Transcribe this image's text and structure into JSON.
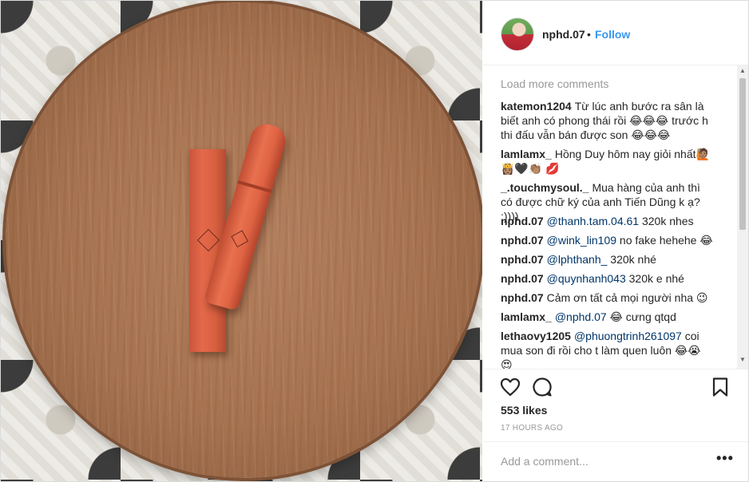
{
  "post": {
    "username": "nphd.07",
    "separator": "•",
    "follow_label": "Follow",
    "avatar_icon": "profile-avatar"
  },
  "comments": {
    "load_more": "Load more comments",
    "items": [
      {
        "user": "katemon1204",
        "mention": "",
        "text": "Từ lúc anh bước ra sân là biết anh có phong thái rồi 😂😂😂 trước h thi đấu vẫn bán được son 😂😂😂"
      },
      {
        "user": "lamlamx_",
        "mention": "",
        "text": "Hồng Duy hôm nay giỏi nhất🙋🏽 👸🏽🖤👏🏽 💋"
      },
      {
        "user": "_.touchmysoul._",
        "mention": "",
        "text": "Mua hàng của anh thì có được chữ ký của anh Tiến Dũng k ạ? :))))"
      },
      {
        "user": "nphd.07",
        "mention": "@thanh.tam.04.61",
        "text": " 320k nhes"
      },
      {
        "user": "nphd.07",
        "mention": "@wink_lin109",
        "text": " no fake hehehe 😂"
      },
      {
        "user": "nphd.07",
        "mention": "@lphthanh_",
        "text": " 320k nhé"
      },
      {
        "user": "nphd.07",
        "mention": "@quynhanh043",
        "text": " 320k e nhé"
      },
      {
        "user": "nphd.07",
        "mention": "",
        "text": "Cảm ơn tất cả mọi người nha 😉"
      },
      {
        "user": "lamlamx_",
        "mention": "@nphd.07",
        "text": " 😂 cưng qtqd"
      },
      {
        "user": "lethaovy1205",
        "mention": "@phuongtrinh261097",
        "text": " coi mua son đi rồi cho t làm quen luôn 😂😭 😍"
      }
    ]
  },
  "actions": {
    "like_icon": "heart-icon",
    "comment_icon": "comment-icon",
    "save_icon": "bookmark-icon"
  },
  "likes_label": "553 likes",
  "timestamp": "17 HOURS AGO",
  "add_comment": {
    "placeholder": "Add a comment...",
    "more_label": "•••"
  },
  "colors": {
    "accent": "#3897f0",
    "mention": "#003569",
    "muted": "#999999"
  }
}
